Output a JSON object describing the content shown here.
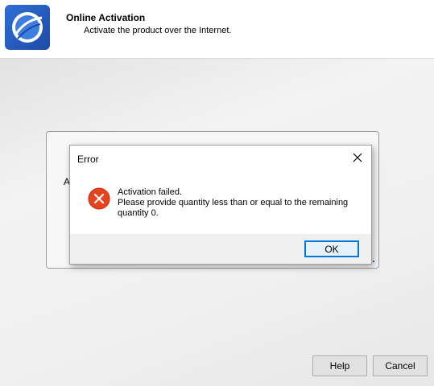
{
  "header": {
    "title": "Online Activation",
    "subtitle": "Activate the product over the Internet.",
    "logo_icon": "globe-logo-icon"
  },
  "panel": {
    "partial_label": "A"
  },
  "buttons": {
    "help": "Help",
    "cancel": "Cancel"
  },
  "dialog": {
    "title": "Error",
    "close_icon": "close-icon",
    "icon": "error-icon",
    "message_lines": [
      "Activation failed.",
      "Please provide quantity less than or equal to the remaining",
      "quantity 0."
    ],
    "ok_label": "OK"
  },
  "colors": {
    "error_red": "#e8431f",
    "focus_blue": "#0078d7",
    "logo_blue": "#2f6fd6"
  }
}
